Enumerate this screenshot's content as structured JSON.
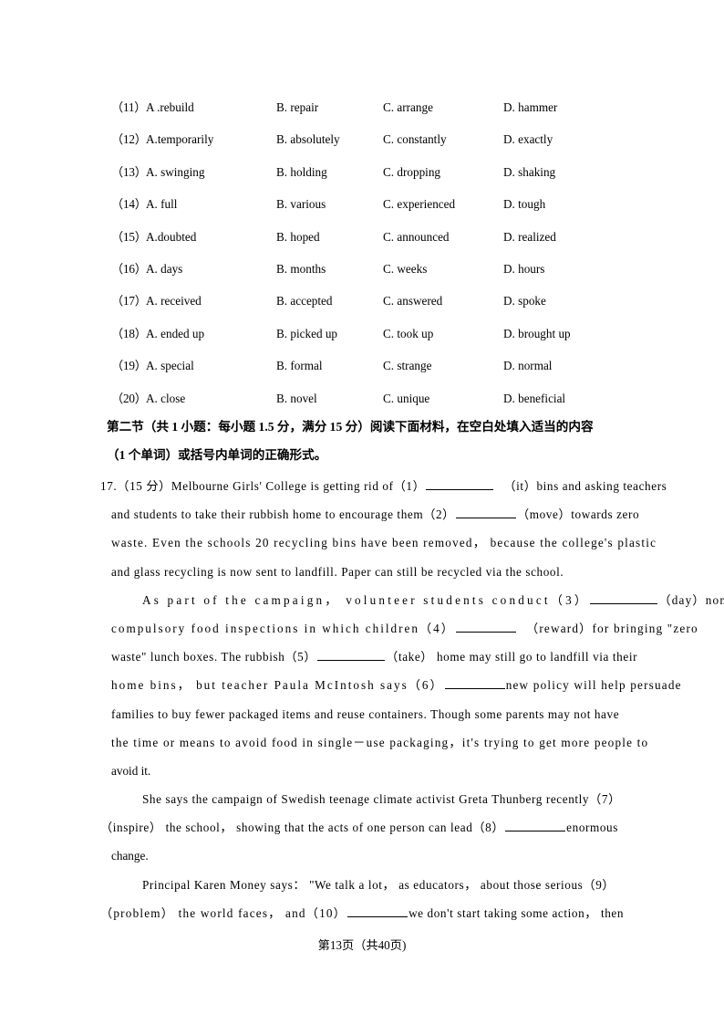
{
  "document": {
    "type": "exam-paper",
    "background": "#ffffff",
    "text_color": "#000000"
  },
  "multiple_choice": {
    "rows": [
      {
        "num": "（11）",
        "a": "A .rebuild",
        "b": "B. repair",
        "c": "C. arrange",
        "d": "D. hammer"
      },
      {
        "num": "（12）",
        "a": "A.temporarily",
        "b": "B. absolutely",
        "c": "C. constantly",
        "d": "D. exactly"
      },
      {
        "num": "（13）",
        "a": "A. swinging",
        "b": "B. holding",
        "c": "C. dropping",
        "d": "D. shaking"
      },
      {
        "num": "（14）",
        "a": "A. full",
        "b": "B. various",
        "c": "C. experienced",
        "d": "D. tough"
      },
      {
        "num": "（15）",
        "a": "A.doubted",
        "b": "B. hoped",
        "c": "C. announced",
        "d": "D. realized"
      },
      {
        "num": "（16）",
        "a": "A. days",
        "b": "B. months",
        "c": "C. weeks",
        "d": "D. hours"
      },
      {
        "num": "（17）",
        "a": "A. received",
        "b": "B. accepted",
        "c": "C. answered",
        "d": "D. spoke"
      },
      {
        "num": "（18）",
        "a": "A. ended up",
        "b": "B. picked up",
        "c": "C. took up",
        "d": "D. brought up"
      },
      {
        "num": "（19）",
        "a": "A. special",
        "b": "B. formal",
        "c": "C. strange",
        "d": "D. normal"
      },
      {
        "num": "（20）",
        "a": "A. close",
        "b": "B. novel",
        "c": "C. unique",
        "d": "D. beneficial"
      }
    ]
  },
  "section_heading": {
    "line1": "第二节（共 1 小题：每小题 1.5 分，满分 15 分）阅读下面材料，在空白处填入适当的内容",
    "line2": "（1 个单词）或括号内单词的正确形式。"
  },
  "passage": {
    "question_number": "17.",
    "marks": "（15 分）",
    "para1": {
      "l1_a": "17.（15 分）Melbourne Girls' College is getting rid of（1）",
      "l1_b": "（it）bins and asking teachers",
      "l2_a": "and students to take their rubbish home to encourage them（2）",
      "l2_b": "（move）towards zero",
      "l3": "waste. Even the schools 20 recycling bins have been removed，  because the college's plastic",
      "l4": "and glass recycling is now sent to landfill. Paper can still be recycled via the school."
    },
    "para2": {
      "l1_a": "As part of the campaign， volunteer students conduct（3）",
      "l1_b": "（day）non－",
      "l2_a": "compulsory food inspections in which children（4）",
      "l2_b": "（reward）for bringing \"zero",
      "l3_a": "waste\" lunch boxes. The rubbish（5）",
      "l3_b": "（take） home may still go to landfill via their",
      "l4_a": "home bins，  but teacher Paula McIntosh says（6）",
      "l4_b": "new policy will help persuade",
      "l5": "families to buy fewer packaged items and reuse containers. Though some parents may not have",
      "l6": "the time or means to avoid food in single－use packaging，it's trying to get more people to",
      "l7": "avoid it."
    },
    "para3": {
      "l1": "She says the campaign of Swedish teenage climate activist Greta Thunberg recently（7）",
      "l2_a": "（inspire） the school，  showing that the acts of one person can lead（8）",
      "l2_b": "enormous",
      "l3": "change."
    },
    "para4": {
      "l1": "Principal Karen Money says： \"We talk a lot， as educators， about those serious（9）",
      "l2_a": "（problem） the world faces， and（10）",
      "l2_b": "we don't start taking some action， then"
    }
  },
  "footer": {
    "page_label": "第13页（共40页)"
  }
}
